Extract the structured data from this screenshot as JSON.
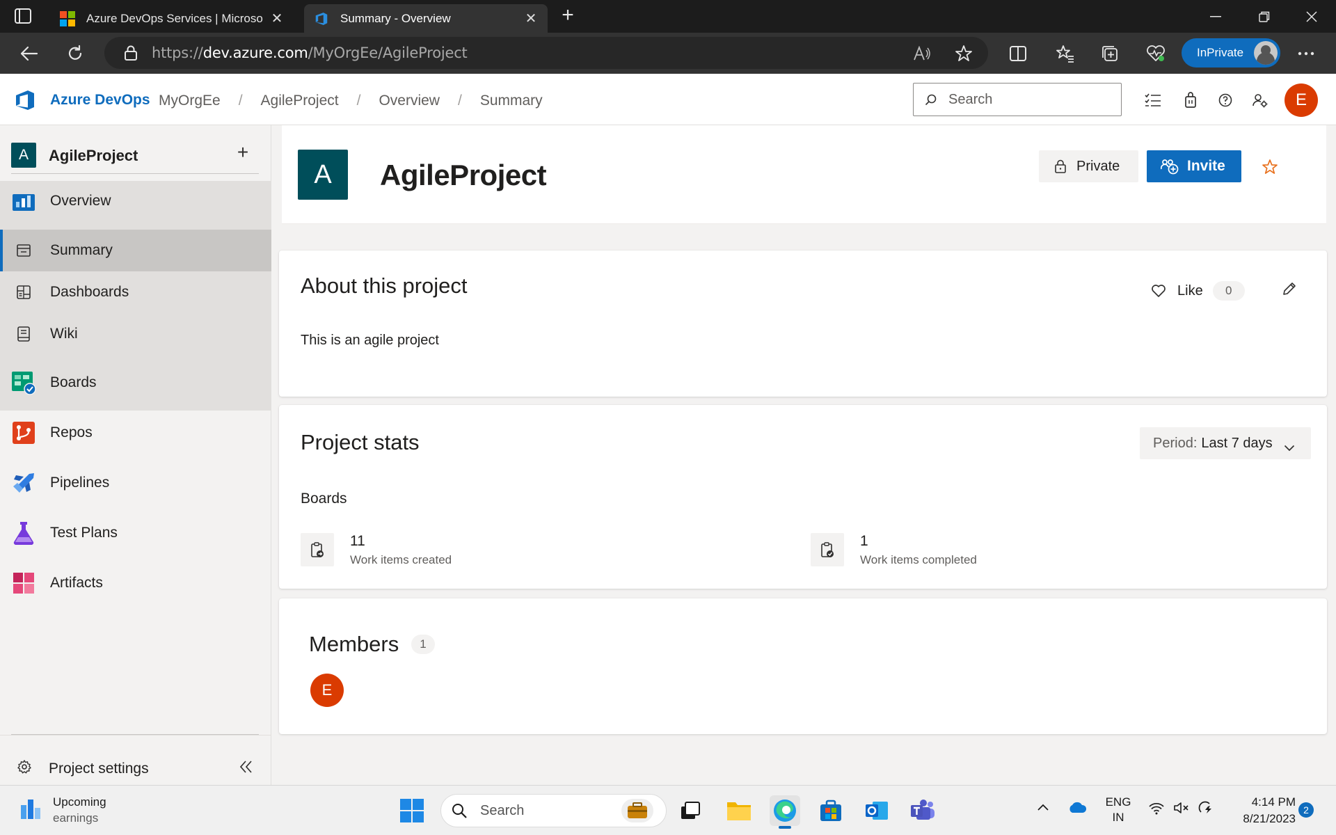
{
  "browser": {
    "tabs": [
      {
        "title": "Azure DevOps Services | Microso",
        "active": false
      },
      {
        "title": "Summary - Overview",
        "active": true
      }
    ],
    "url_prefix": "https://",
    "url_domain": "dev.azure.com",
    "url_path": "/MyOrgEe/AgileProject",
    "inprivate_label": "InPrivate"
  },
  "header": {
    "brand": "Azure DevOps",
    "breadcrumbs": [
      "MyOrgEe",
      "AgileProject",
      "Overview",
      "Summary"
    ],
    "search_placeholder": "Search",
    "user_initial": "E"
  },
  "sidebar": {
    "project_initial": "A",
    "project_name": "AgileProject",
    "items": [
      {
        "label": "Overview",
        "icon": "overview-icon"
      },
      {
        "label": "Summary",
        "icon": "summary-icon",
        "selected": true
      },
      {
        "label": "Dashboards",
        "icon": "dashboards-icon"
      },
      {
        "label": "Wiki",
        "icon": "wiki-icon"
      },
      {
        "label": "Boards",
        "icon": "boards-icon"
      },
      {
        "label": "Repos",
        "icon": "repos-icon"
      },
      {
        "label": "Pipelines",
        "icon": "pipelines-icon"
      },
      {
        "label": "Test Plans",
        "icon": "test-plans-icon"
      },
      {
        "label": "Artifacts",
        "icon": "artifacts-icon"
      }
    ],
    "footer_label": "Project settings"
  },
  "main": {
    "project_initial": "A",
    "project_title": "AgileProject",
    "private_label": "Private",
    "invite_label": "Invite",
    "about": {
      "heading": "About this project",
      "description": "This is an agile project",
      "like_label": "Like",
      "like_count": "0"
    },
    "stats": {
      "heading": "Project stats",
      "period_label": "Period:",
      "period_value": "Last 7 days",
      "section": "Boards",
      "items": [
        {
          "value": "11",
          "label": "Work items created"
        },
        {
          "value": "1",
          "label": "Work items completed"
        }
      ]
    },
    "members": {
      "heading": "Members",
      "count": "1",
      "avatars": [
        "E"
      ]
    }
  },
  "taskbar": {
    "weather_line1": "Upcoming",
    "weather_line2": "earnings",
    "search_label": "Search",
    "lang_line1": "ENG",
    "lang_line2": "IN",
    "time": "4:14 PM",
    "date": "8/21/2023",
    "notification_count": "2"
  },
  "colors": {
    "accent": "#0f6cbd",
    "project_avatar": "#004e5a",
    "user_avatar": "#da3b01"
  }
}
